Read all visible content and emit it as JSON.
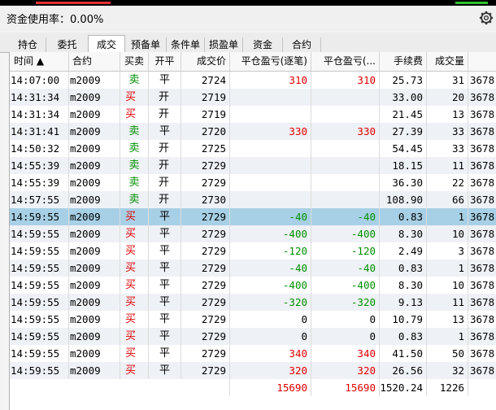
{
  "header": {
    "title": "资金使用率：",
    "value": "0.00%"
  },
  "tabs": [
    "持仓",
    "委托",
    "成交",
    "预备单",
    "条件单",
    "损盈单",
    "资金",
    "合约"
  ],
  "active_tab": "成交",
  "columns": [
    "时间 ▲",
    "合约",
    "买卖",
    "开平",
    "成交价",
    "平仓盈亏(逐笔)",
    "平仓盈亏(...",
    "手续费",
    "成交量"
  ],
  "rows": [
    [
      "14:07:00",
      "m2009",
      "卖",
      "平",
      "2724",
      "310",
      "310",
      "25.73",
      "31",
      "3678"
    ],
    [
      "14:31:34",
      "m2009",
      "买",
      "开",
      "2719",
      "",
      "",
      "33.00",
      "20",
      "3678"
    ],
    [
      "14:31:34",
      "m2009",
      "买",
      "开",
      "2719",
      "",
      "",
      "21.45",
      "13",
      "3678"
    ],
    [
      "14:31:41",
      "m2009",
      "卖",
      "平",
      "2720",
      "330",
      "330",
      "27.39",
      "33",
      "3678"
    ],
    [
      "14:50:32",
      "m2009",
      "卖",
      "开",
      "2725",
      "",
      "",
      "54.45",
      "33",
      "3678"
    ],
    [
      "14:55:39",
      "m2009",
      "卖",
      "开",
      "2729",
      "",
      "",
      "18.15",
      "11",
      "3678"
    ],
    [
      "14:55:39",
      "m2009",
      "卖",
      "开",
      "2729",
      "",
      "",
      "36.30",
      "22",
      "3678"
    ],
    [
      "14:57:55",
      "m2009",
      "卖",
      "开",
      "2730",
      "",
      "",
      "108.90",
      "66",
      "3678"
    ],
    [
      "14:59:55",
      "m2009",
      "买",
      "平",
      "2729",
      "-40",
      "-40",
      "0.83",
      "1",
      "3678"
    ],
    [
      "14:59:55",
      "m2009",
      "买",
      "平",
      "2729",
      "-400",
      "-400",
      "8.30",
      "10",
      "3678"
    ],
    [
      "14:59:55",
      "m2009",
      "买",
      "平",
      "2729",
      "-120",
      "-120",
      "2.49",
      "3",
      "3678"
    ],
    [
      "14:59:55",
      "m2009",
      "买",
      "平",
      "2729",
      "-40",
      "-40",
      "0.83",
      "1",
      "3678"
    ],
    [
      "14:59:55",
      "m2009",
      "买",
      "平",
      "2729",
      "-400",
      "-400",
      "8.30",
      "10",
      "3678"
    ],
    [
      "14:59:55",
      "m2009",
      "买",
      "平",
      "2729",
      "-320",
      "-320",
      "9.13",
      "11",
      "3678"
    ],
    [
      "14:59:55",
      "m2009",
      "买",
      "平",
      "2729",
      "0",
      "0",
      "10.79",
      "13",
      "3678"
    ],
    [
      "14:59:55",
      "m2009",
      "买",
      "平",
      "2729",
      "0",
      "0",
      "0.83",
      "1",
      "3678"
    ],
    [
      "14:59:55",
      "m2009",
      "买",
      "平",
      "2729",
      "340",
      "340",
      "41.50",
      "50",
      "3678"
    ],
    [
      "14:59:55",
      "m2009",
      "买",
      "平",
      "2729",
      "320",
      "320",
      "26.56",
      "32",
      "3678"
    ]
  ],
  "selected_row": 8,
  "totals": [
    "15690",
    "15690",
    "1520.24",
    "1226"
  ],
  "colors": {
    "buy": "#e00000",
    "sell": "#009000",
    "selected": "#a7d0e6"
  },
  "icons": {
    "settings": "gear-icon"
  }
}
